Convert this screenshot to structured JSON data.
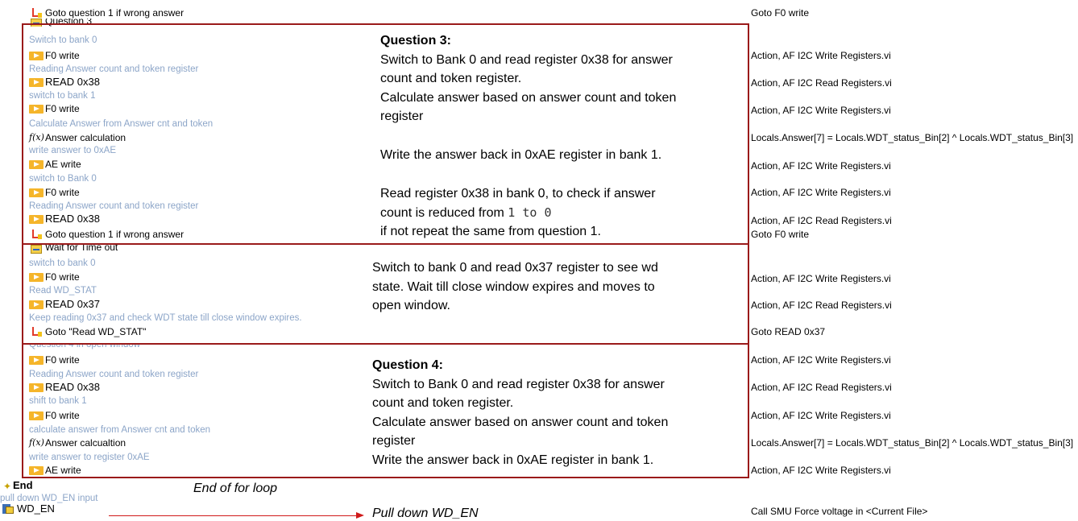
{
  "steps": {
    "top_goto": "Goto question 1 if wrong answer",
    "q3_label": "Question 3",
    "q3_c1": "Switch to bank 0",
    "q3_s1": "F0 write",
    "q3_c2": "Reading Answer count and token register",
    "q3_s2": "READ 0x38",
    "q3_c3": "switch to bank 1",
    "q3_s3": "F0 write",
    "q3_c4": "Calculate Answer from Answer cnt and token",
    "q3_s4": "Answer calculation",
    "q3_c5": "write answer to 0xAE",
    "q3_s5": "AE write",
    "q3_c6": "switch to Bank 0",
    "q3_s6": "F0 write",
    "q3_c7": "Reading Answer count and token register",
    "q3_s7": "READ 0x38",
    "q3_s8": "Goto question 1 if wrong answer",
    "wt_label": "Wait for Time out",
    "wt_c1": "switch to bank 0",
    "wt_s1": "F0 write",
    "wt_c2": "Read WD_STAT",
    "wt_s2": "READ 0x37",
    "wt_c3": "Keep reading 0x37 and check WDT state till close window expires.",
    "wt_s3": "Goto \"Read WD_STAT\"",
    "q4_label": "Question 4 in open window",
    "q4_s1": "F0 write",
    "q4_c2": "Reading Answer count and token register",
    "q4_s2": "READ 0x38",
    "q4_c3": "shift to bank 1",
    "q4_s3": "F0 write",
    "q4_c4": "calculate answer from Answer cnt and token",
    "q4_s4": "Answer calcualtion",
    "q4_c5": "write answer to register 0xAE",
    "q4_s5": "AE write",
    "end": "End",
    "pull_c": "pull down WD_EN input",
    "wd_en": "WD_EN"
  },
  "right_col": {
    "r0": "Goto F0 write",
    "r1": "Action,  AF I2C Write Registers.vi",
    "r2": "Action,  AF I2C Read Registers.vi",
    "r3": "Action,  AF I2C Write Registers.vi",
    "r4": "Locals.Answer[7] = Locals.WDT_status_Bin[2] ^ Locals.WDT_status_Bin[3]",
    "r5": "Action,  AF I2C Write Registers.vi",
    "r6": "Action,  AF I2C Write Registers.vi",
    "r7": "Action,  AF I2C Read Registers.vi",
    "r8": "Goto F0 write",
    "r9": "Action,  AF I2C Write Registers.vi",
    "r10": "Action,  AF I2C Read Registers.vi",
    "r11": "Goto READ 0x37",
    "r12": "Action,  AF I2C Write Registers.vi",
    "r13": "Action,  AF I2C Read Registers.vi",
    "r14": "Action,  AF I2C Write Registers.vi",
    "r15": "Locals.Answer[7] = Locals.WDT_status_Bin[2] ^ Locals.WDT_status_Bin[3]",
    "r16": "Action,  AF I2C Write Registers.vi",
    "r17": "Call SMU Force voltage in <Current File>"
  },
  "notes": {
    "q3_title": "Question 3:",
    "q3_l1": "Switch to Bank 0 and read register 0x38 for answer",
    "q3_l2": "count and token register.",
    "q3_l3": "Calculate answer based on answer count and token",
    "q3_l4": "register",
    "q3_l5": "Write the answer back in 0xAE register in bank 1.",
    "q3_l6": "Read register 0x38 in bank 0, to check if answer",
    "q3_l7a": "count is reduced from ",
    "q3_l7b": "1 to 0",
    "q3_l8": "if not repeat the same from question 1.",
    "wt_l1": "Switch to bank 0 and read 0x37 register to see wd",
    "wt_l2": "state. Wait till close window expires and moves to",
    "wt_l3": "open window.",
    "q4_title": "Question 4:",
    "q4_l1": "Switch to Bank 0 and read register 0x38 for answer",
    "q4_l2": "count and token register.",
    "q4_l3": "Calculate answer based on answer count and token",
    "q4_l4": "register",
    "q4_l5": "Write the answer back in 0xAE register in bank 1.",
    "end_loop": "End of for loop",
    "pull_down": "Pull down WD_EN"
  },
  "colors": {
    "comment": "#8ca5c8",
    "box_border": "#9a1a1a",
    "action_icon": "#f5b52a",
    "arrow": "#d01a1a"
  }
}
